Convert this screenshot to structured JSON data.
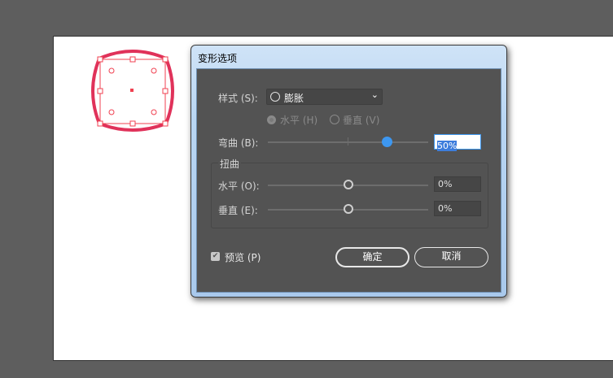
{
  "dialog": {
    "title": "变形选项"
  },
  "style": {
    "label": "样式 (S):",
    "value": "膨胀",
    "icon": "circle-outline-icon"
  },
  "orientation": {
    "horizontal": "水平 (H)",
    "vertical": "垂直 (V)",
    "selected": "horizontal"
  },
  "bend": {
    "label": "弯曲 (B):",
    "value": "50%",
    "percent": 50
  },
  "distortion": {
    "group": "扭曲",
    "horizontal": {
      "label": "水平 (O):",
      "value": "0%",
      "percent": 0
    },
    "vertical": {
      "label": "垂直 (E):",
      "value": "0%",
      "percent": 0
    }
  },
  "preview": {
    "label": "预览 (P)",
    "checked": true
  },
  "buttons": {
    "ok": "确定",
    "cancel": "取消"
  },
  "colors": {
    "shape": "#e0325a",
    "selection": "#f04050",
    "accent": "#3d97f0"
  }
}
